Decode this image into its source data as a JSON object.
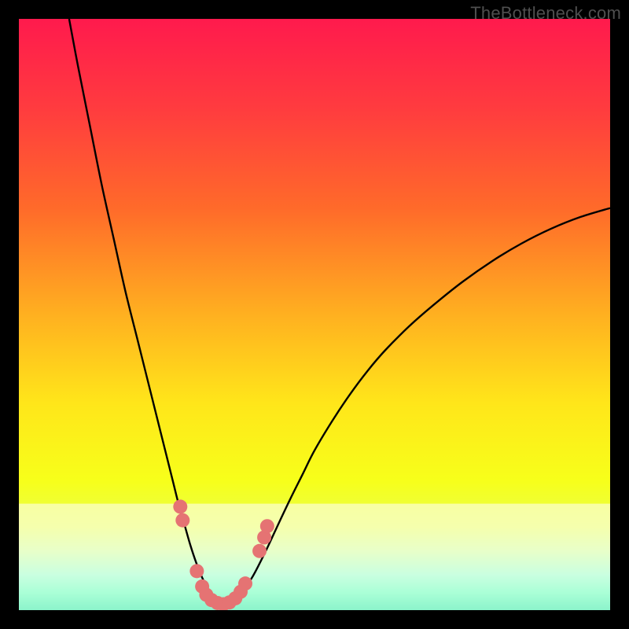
{
  "watermark": "TheBottleneck.com",
  "chart_data": {
    "type": "line",
    "title": "",
    "xlabel": "",
    "ylabel": "",
    "xlim": [
      0,
      100
    ],
    "ylim": [
      0,
      100
    ],
    "grid": false,
    "series": [
      {
        "name": "left-curve",
        "x": [
          8.5,
          10,
          12,
          14,
          16,
          18,
          20,
          22,
          24,
          26,
          27,
          28,
          29,
          30,
          31,
          32,
          33,
          34,
          35
        ],
        "y": [
          100,
          92,
          82,
          72,
          63,
          54,
          46,
          38,
          30,
          22,
          18,
          14.5,
          11,
          8,
          5.5,
          3.6,
          2.3,
          1.4,
          0.9
        ]
      },
      {
        "name": "right-curve",
        "x": [
          35,
          36,
          37,
          38,
          39,
          40,
          42,
          44,
          46,
          48,
          50,
          53,
          56,
          59,
          62,
          66,
          70,
          75,
          80,
          85,
          90,
          95,
          100
        ],
        "y": [
          0.9,
          1.4,
          2.2,
          3.3,
          4.8,
          6.5,
          10.5,
          14.8,
          19,
          23,
          27,
          32,
          36.5,
          40.5,
          44,
          48,
          51.5,
          55.5,
          59,
          62,
          64.5,
          66.5,
          68
        ]
      }
    ],
    "markers": {
      "name": "dots",
      "color": "#e57373",
      "points": [
        {
          "x": 27.3,
          "y": 17.5
        },
        {
          "x": 27.7,
          "y": 15.2
        },
        {
          "x": 30.1,
          "y": 6.6
        },
        {
          "x": 31.0,
          "y": 4.0
        },
        {
          "x": 31.7,
          "y": 2.6
        },
        {
          "x": 32.6,
          "y": 1.7
        },
        {
          "x": 33.6,
          "y": 1.2
        },
        {
          "x": 34.6,
          "y": 1.0
        },
        {
          "x": 35.6,
          "y": 1.3
        },
        {
          "x": 36.6,
          "y": 2.0
        },
        {
          "x": 37.5,
          "y": 3.1
        },
        {
          "x": 38.3,
          "y": 4.5
        },
        {
          "x": 40.7,
          "y": 10.0
        },
        {
          "x": 41.5,
          "y": 12.3
        },
        {
          "x": 42.0,
          "y": 14.2
        }
      ]
    },
    "gradient_stops": [
      {
        "offset": 0.0,
        "color": "#ff1a4d"
      },
      {
        "offset": 0.15,
        "color": "#ff3b3f"
      },
      {
        "offset": 0.32,
        "color": "#ff6a2a"
      },
      {
        "offset": 0.5,
        "color": "#ffb020"
      },
      {
        "offset": 0.65,
        "color": "#ffe61a"
      },
      {
        "offset": 0.78,
        "color": "#f7ff1a"
      },
      {
        "offset": 0.86,
        "color": "#e8ff4a"
      },
      {
        "offset": 0.9,
        "color": "#ccff88"
      },
      {
        "offset": 0.94,
        "color": "#89ffbb"
      },
      {
        "offset": 0.97,
        "color": "#44ffa6"
      },
      {
        "offset": 1.0,
        "color": "#00e58c"
      }
    ],
    "band": {
      "top": 0.82,
      "bottom": 1.0,
      "alpha": 0.55,
      "color": "#ffffff"
    }
  }
}
